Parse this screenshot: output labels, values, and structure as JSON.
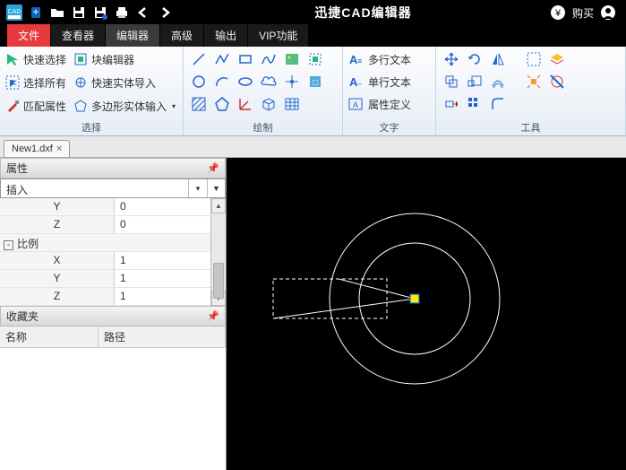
{
  "title": "迅捷CAD编辑器",
  "titlebar_right": [
    "购买"
  ],
  "menutabs": [
    "文件",
    "查看器",
    "编辑器",
    "高级",
    "输出",
    "VIP功能"
  ],
  "active_menutab": "文件",
  "ribbon": {
    "select": {
      "items": [
        "快速选择",
        "选择所有",
        "匹配属性"
      ],
      "items2": [
        "块编辑器",
        "快速实体导入",
        "多边形实体输入"
      ],
      "label": "选择"
    },
    "draw": {
      "label": "绘制"
    },
    "text": {
      "items": [
        "多行文本",
        "单行文本",
        "属性定义"
      ],
      "label": "文字"
    },
    "tool": {
      "label": "工具"
    }
  },
  "filetab": {
    "name": "New1.dxf"
  },
  "panels": {
    "prop_hdr": "属性",
    "combo": "插入",
    "rows": [
      {
        "k": "Y",
        "v": "0"
      },
      {
        "k": "Z",
        "v": "0"
      },
      {
        "group": "比例"
      },
      {
        "k": "X",
        "v": "1"
      },
      {
        "k": "Y",
        "v": "1"
      },
      {
        "k": "Z",
        "v": "1"
      }
    ],
    "fav_hdr": "收藏夹",
    "fav_cols": [
      "名称",
      "路径"
    ]
  }
}
